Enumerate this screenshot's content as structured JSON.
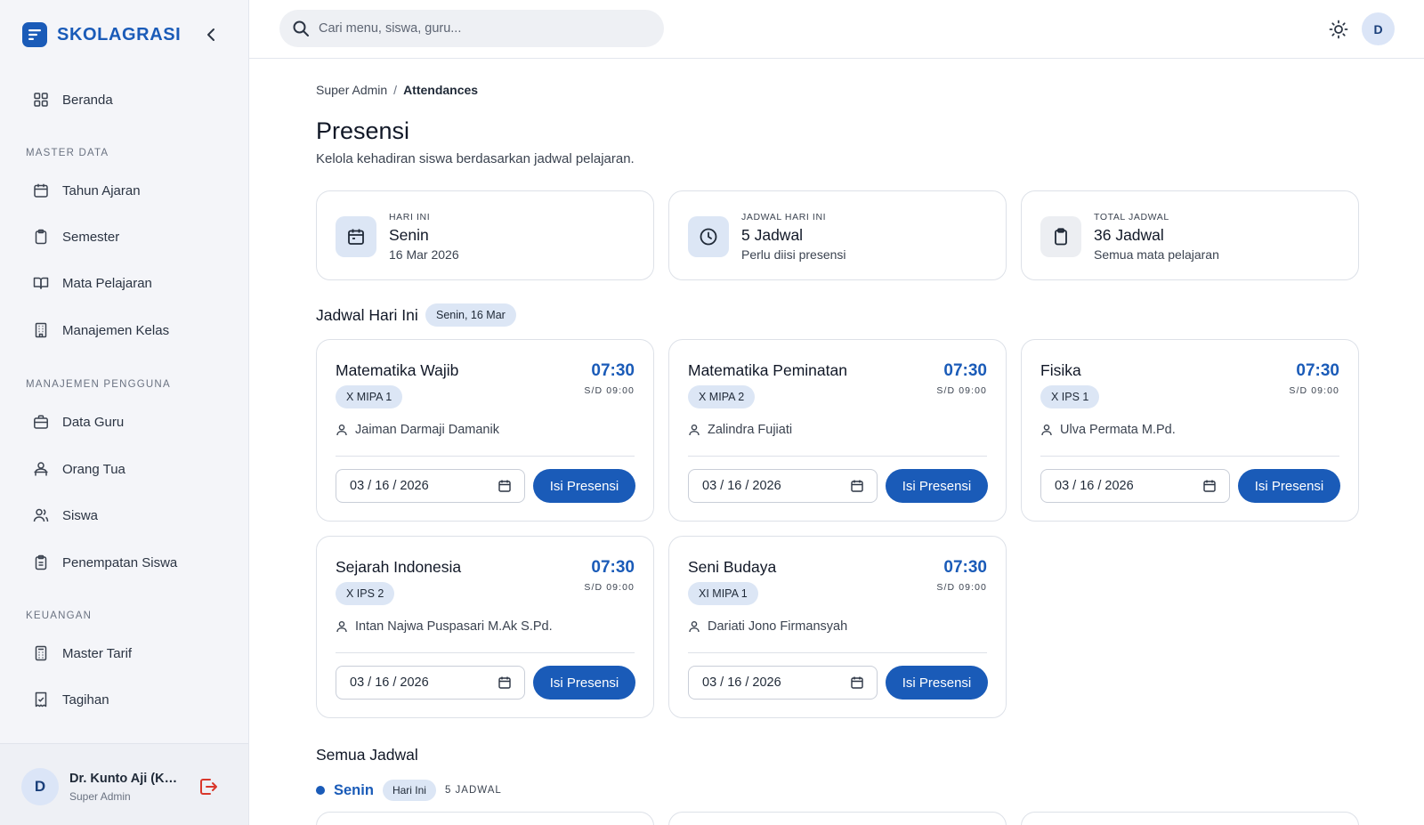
{
  "brand": {
    "name": "SKOLAGRASI"
  },
  "search": {
    "placeholder": "Cari menu, siswa, guru..."
  },
  "topbar": {
    "avatar_initial": "D"
  },
  "sidebar": {
    "home": "Beranda",
    "sections": {
      "master_data": "MASTER DATA",
      "user_mgmt": "MANAJEMEN PENGGUNA",
      "finance": "KEUANGAN"
    },
    "items": {
      "tahun_ajaran": "Tahun Ajaran",
      "semester": "Semester",
      "mata_pelajaran": "Mata Pelajaran",
      "manajemen_kelas": "Manajemen Kelas",
      "data_guru": "Data Guru",
      "orang_tua": "Orang Tua",
      "siswa": "Siswa",
      "penempatan_siswa": "Penempatan Siswa",
      "master_tarif": "Master Tarif",
      "tagihan": "Tagihan"
    },
    "user": {
      "initial": "D",
      "name": "Dr. Kunto Aji (Kepala Sekolah)",
      "role": "Super Admin"
    }
  },
  "breadcrumb": {
    "root": "Super Admin",
    "separator": "/",
    "current": "Attendances"
  },
  "page": {
    "title": "Presensi",
    "subtitle": "Kelola kehadiran siswa berdasarkan jadwal pelajaran."
  },
  "stats": [
    {
      "label": "HARI INI",
      "value": "Senin",
      "sub": "16 Mar 2026"
    },
    {
      "label": "JADWAL HARI INI",
      "value": "5 Jadwal",
      "sub": "Perlu diisi presensi"
    },
    {
      "label": "TOTAL JADWAL",
      "value": "36 Jadwal",
      "sub": "Semua mata pelajaran"
    }
  ],
  "today": {
    "title": "Jadwal Hari Ini",
    "date_pill": "Senin, 16 Mar",
    "button_label": "Isi Presensi",
    "schedules": [
      {
        "subject": "Matematika Wajib",
        "class": "X MIPA 1",
        "time": "07:30",
        "until": "S/D 09:00",
        "teacher": "Jaiman Darmaji Damanik",
        "date": "03 / 16 / 2026"
      },
      {
        "subject": "Matematika Peminatan",
        "class": "X MIPA 2",
        "time": "07:30",
        "until": "S/D 09:00",
        "teacher": "Zalindra Fujiati",
        "date": "03 / 16 / 2026"
      },
      {
        "subject": "Fisika",
        "class": "X IPS 1",
        "time": "07:30",
        "until": "S/D 09:00",
        "teacher": "Ulva Permata M.Pd.",
        "date": "03 / 16 / 2026"
      },
      {
        "subject": "Sejarah Indonesia",
        "class": "X IPS 2",
        "time": "07:30",
        "until": "S/D 09:00",
        "teacher": "Intan Najwa Puspasari M.Ak S.Pd.",
        "date": "03 / 16 / 2026"
      },
      {
        "subject": "Seni Budaya",
        "class": "XI MIPA 1",
        "time": "07:30",
        "until": "S/D 09:00",
        "teacher": "Dariati Jono Firmansyah",
        "date": "03 / 16 / 2026"
      }
    ]
  },
  "all_schedules": {
    "title": "Semua Jadwal",
    "day": "Senin",
    "today_pill": "Hari Ini",
    "count": "5 JADWAL"
  },
  "colors": {
    "primary": "#1a5bb8",
    "pill_bg": "#dce6f5",
    "sidebar_bg": "#f4f5f9",
    "logout": "#d9372b"
  },
  "icons": {
    "stats": [
      "calendar-icon",
      "clock-icon",
      "clipboard-icon"
    ]
  }
}
